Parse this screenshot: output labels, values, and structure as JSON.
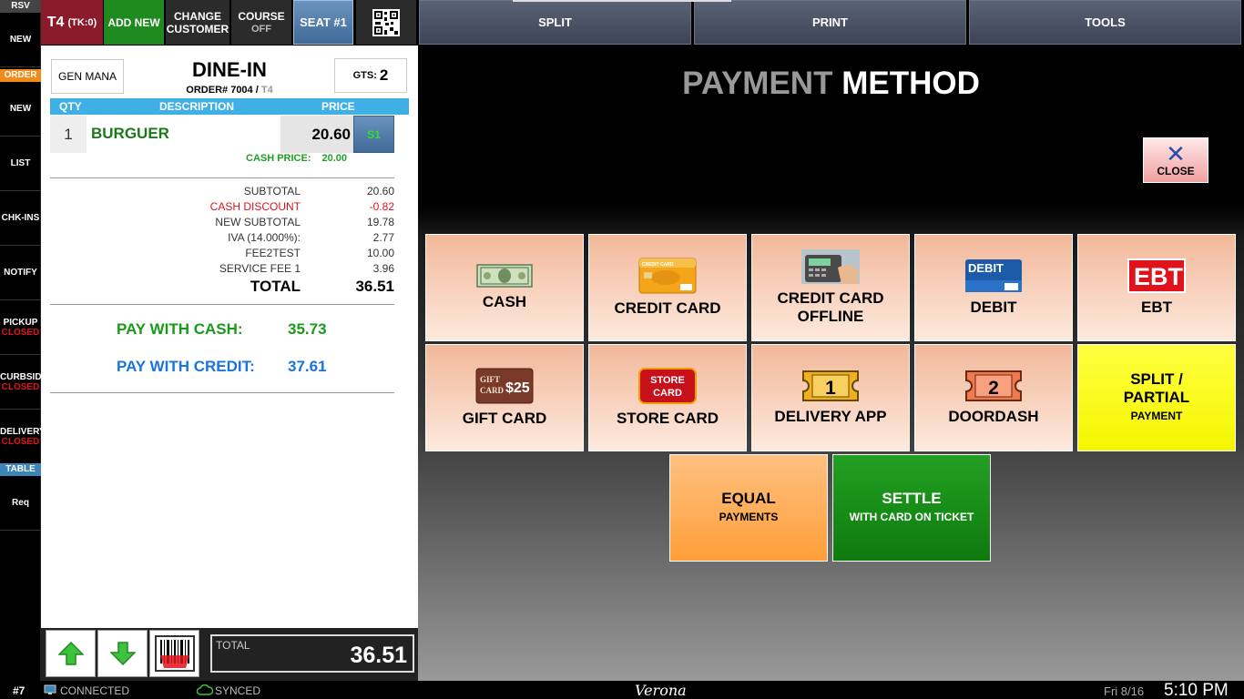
{
  "sidebar": {
    "rsv": "RSV",
    "new_top": "NEW",
    "order_head": "ORDER",
    "new": "NEW",
    "list": "LIST",
    "chkins": "CHK-INS",
    "notify": "NOTIFY",
    "pickup": "PICKUP",
    "pickup_status": "CLOSED",
    "curbside": "CURBSID",
    "curbside_status": "CLOSED",
    "delivery": "DELIVERY",
    "delivery_status": "CLOSED",
    "table_head": "TABLE",
    "req": "Req"
  },
  "topbar": {
    "table": "T4",
    "ticket": "(TK:0)",
    "add_new": "ADD NEW",
    "change": "CHANGE",
    "customer": "CUSTOMER",
    "course": "COURSE",
    "course_state": "OFF",
    "seat": "SEAT #1",
    "split": "SPLIT",
    "print": "PRINT",
    "tools": "TOOLS"
  },
  "order": {
    "server": "GEN MANA",
    "type": "DINE-IN",
    "order_label": "ORDER# 7004 /",
    "table": "T4",
    "gts_label": "GTS:",
    "gts_value": "2",
    "col_qty": "QTY",
    "col_desc": "DESCRIPTION",
    "col_price": "PRICE",
    "item_qty": "1",
    "item_desc": "BURGUER",
    "item_price": "20.60",
    "item_seat": "S1",
    "cash_price_label": "CASH PRICE:",
    "cash_price_value": "20.00"
  },
  "summary": [
    {
      "label": "SUBTOTAL",
      "value": "20.60"
    },
    {
      "label": "CASH DISCOUNT",
      "value": "-0.82"
    },
    {
      "label": "NEW SUBTOTAL",
      "value": "19.78"
    },
    {
      "label": "IVA (14.000%):",
      "value": "2.77"
    },
    {
      "label": "FEE2TEST",
      "value": "10.00"
    },
    {
      "label": "SERVICE FEE 1",
      "value": "3.96"
    },
    {
      "label": "TOTAL",
      "value": "36.51"
    }
  ],
  "pay": {
    "cash_label": "PAY WITH CASH:",
    "cash_value": "35.73",
    "credit_label": "PAY WITH CREDIT:",
    "credit_value": "37.61"
  },
  "bottom": {
    "total_label": "TOTAL",
    "total_value": "36.51"
  },
  "main": {
    "title_1": "PAYMENT",
    "title_2": "METHOD",
    "close": "CLOSE"
  },
  "methods": {
    "cash": "CASH",
    "credit_card": "CREDIT CARD",
    "cc_offline_1": "CREDIT CARD",
    "cc_offline_2": "OFFLINE",
    "debit": "DEBIT",
    "ebt": "EBT",
    "gift_card": "GIFT CARD",
    "store_card": "STORE CARD",
    "delivery_app": "DELIVERY APP",
    "doordash": "DOORDASH",
    "split_1": "SPLIT /",
    "split_2": "PARTIAL",
    "split_sub": "PAYMENT",
    "equal": "EQUAL",
    "equal_sub": "PAYMENTS",
    "settle": "SETTLE",
    "settle_sub": "WITH CARD ON TICKET"
  },
  "icon_text": {
    "debit": "DEBIT",
    "ebt": "EBT",
    "gift_1": "GIFT",
    "gift_2": "CARD",
    "gift_amt": "$25",
    "store_1": "STORE",
    "store_2": "CARD",
    "ticket_1": "1",
    "ticket_2": "2",
    "credit": "CREDIT CARD"
  },
  "status": {
    "terminal": "#7",
    "connected": "CONNECTED",
    "synced": "SYNCED",
    "store": "Verona",
    "date": "Fri 8/16",
    "time": "5:10 PM"
  },
  "colors": {
    "accent_blue": "#3fb0e6",
    "closed_red": "#e0121b",
    "cash_green": "#1a9a1a",
    "credit_blue": "#1a74e0"
  }
}
